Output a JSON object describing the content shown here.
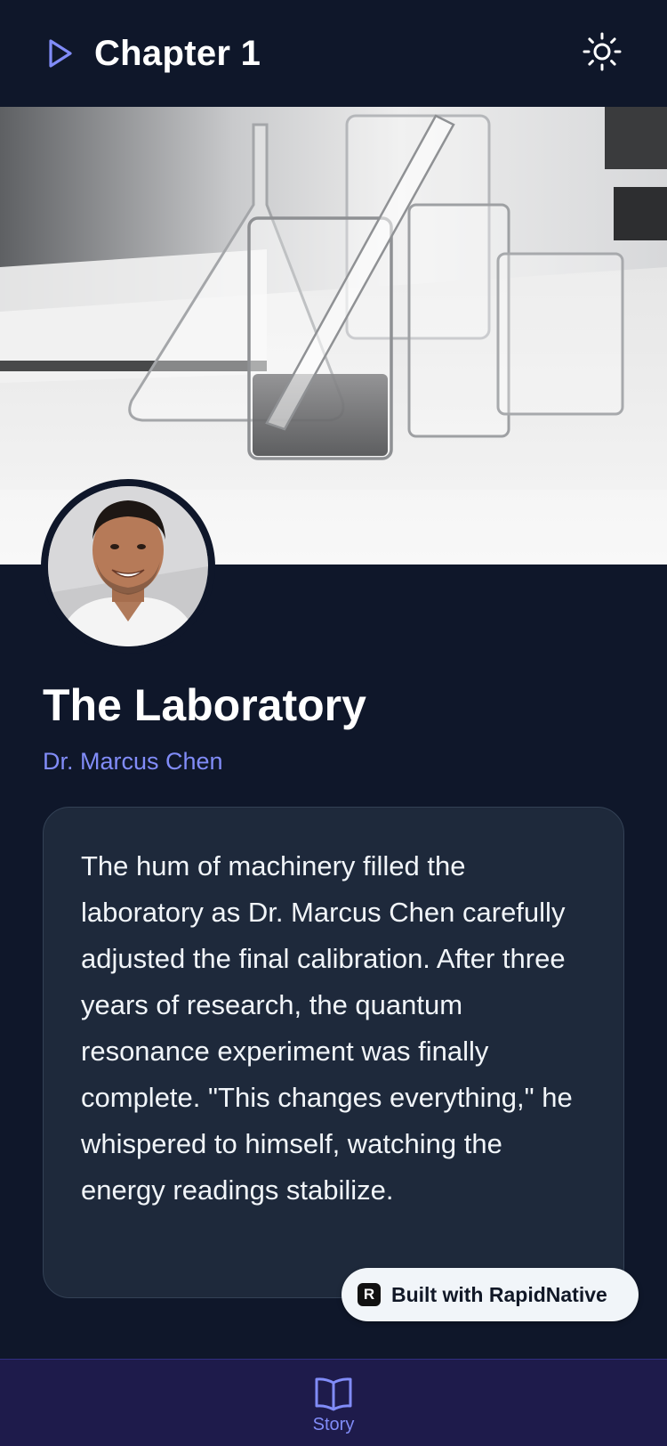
{
  "header": {
    "title": "Chapter 1",
    "play_icon": "play-outline-icon",
    "theme_icon": "sun-icon"
  },
  "hero": {
    "image": "laboratory-glassware-photo"
  },
  "author_avatar": {
    "image": "author-portrait"
  },
  "story": {
    "title": "The Laboratory",
    "author": "Dr. Marcus Chen",
    "text": "The hum of machinery filled the laboratory as Dr. Marcus Chen carefully adjusted the final calibration. After three years of research, the quantum resonance experiment was finally complete. \"This changes everything,\" he whispered to himself, watching the energy readings stabilize."
  },
  "badge": {
    "logo_letter": "R",
    "label": "Built with RapidNative"
  },
  "tabbar": {
    "tabs": [
      {
        "label": "Story",
        "icon": "open-book-icon",
        "active": true
      }
    ]
  },
  "colors": {
    "background": "#0f172a",
    "card": "#1e293b",
    "accent": "#818cf8",
    "tabbar": "#1e1b4b"
  }
}
